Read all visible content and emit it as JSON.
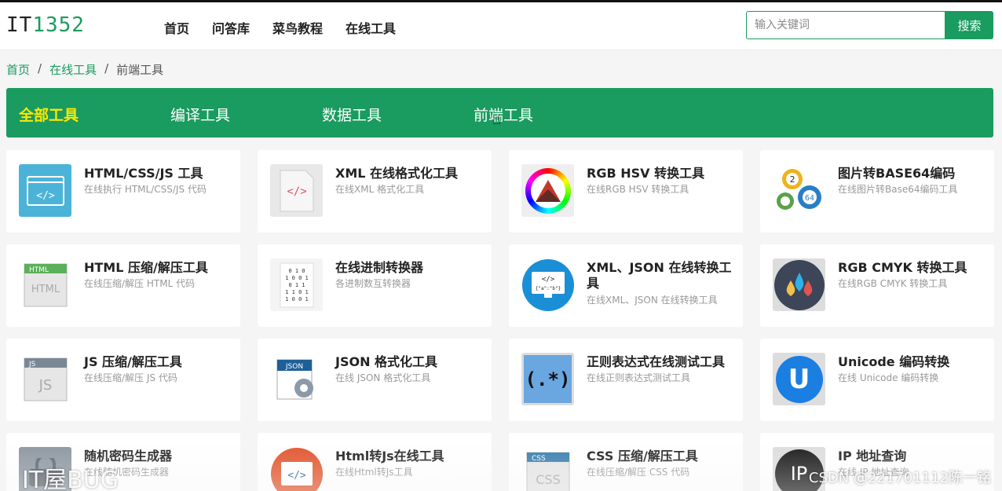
{
  "logo": {
    "part1": "IT",
    "part2": "1352"
  },
  "nav": [
    "首页",
    "问答库",
    "菜鸟教程",
    "在线工具"
  ],
  "search": {
    "placeholder": "输入关键词",
    "button": "搜索"
  },
  "breadcrumb": {
    "home": "首页",
    "tools": "在线工具",
    "current": "前端工具",
    "separator": "/"
  },
  "categories": [
    "全部工具",
    "编译工具",
    "数据工具",
    "前端工具"
  ],
  "active_category": "全部工具",
  "cards": [
    {
      "title": "HTML/CSS/JS 工具",
      "desc": "在线执行 HTML/CSS/JS 代码",
      "icon": "code-window-icon"
    },
    {
      "title": "XML 在线格式化工具",
      "desc": "在线XML 格式化工具",
      "icon": "xml-file-icon"
    },
    {
      "title": "RGB HSV 转换工具",
      "desc": "在线RGB HSV 转换工具",
      "icon": "color-wheel-icon"
    },
    {
      "title": "图片转BASE64编码",
      "desc": "在线图片转Base64编码工具",
      "icon": "gears-base64-icon"
    },
    {
      "title": "HTML 压缩/解压工具",
      "desc": "在线压缩/解压 HTML 代码",
      "icon": "html-document-icon"
    },
    {
      "title": "在线进制转换器",
      "desc": "各进制数互转换器",
      "icon": "binary-sheet-icon"
    },
    {
      "title": "XML、JSON 在线转换工具",
      "desc": "在线XML、JSON 在线转换工具",
      "icon": "monitor-json-icon"
    },
    {
      "title": "RGB CMYK 转换工具",
      "desc": "在线RGB CMYK 转换工具",
      "icon": "ink-drops-icon"
    },
    {
      "title": "JS 压缩/解压工具",
      "desc": "在线压缩/解压 JS 代码",
      "icon": "js-document-icon"
    },
    {
      "title": "JSON 格式化工具",
      "desc": "在线 JSON 格式化工具",
      "icon": "json-gear-icon"
    },
    {
      "title": "正则表达式在线测试工具",
      "desc": "在线正则表达式测试工具",
      "icon": "regex-icon"
    },
    {
      "title": "Unicode 编码转换",
      "desc": "在线 Unicode 编码转换",
      "icon": "unicode-u-icon"
    },
    {
      "title": "随机密码生成器",
      "desc": "在线随机密码生成器",
      "icon": "password-icon"
    },
    {
      "title": "Html转Js在线工具",
      "desc": "在线Html转Js工具",
      "icon": "html-to-js-icon"
    },
    {
      "title": "CSS 压缩/解压工具",
      "desc": "在线压缩/解压 CSS 代码",
      "icon": "css-document-icon"
    },
    {
      "title": "IP 地址查询",
      "desc": "在线 IP 地址查询",
      "icon": "ip-icon"
    }
  ],
  "watermarks": {
    "left": "IT屋BUG",
    "right": "CSDN @221701112陈一铭"
  },
  "colors": {
    "accent": "#1a9b5f",
    "active_tab": "#ffe800"
  }
}
